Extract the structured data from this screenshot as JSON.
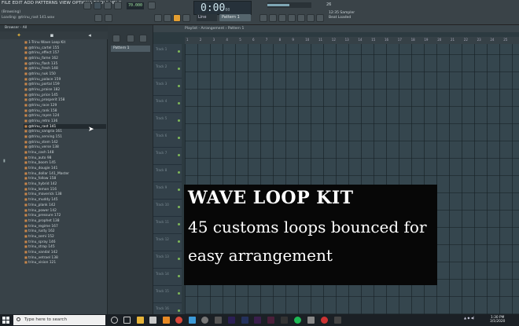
{
  "menubar": "FILE EDIT ADD PATTERNS VIEW OPTIONS TOOLS HELP",
  "hints": [
    "(Browsing)",
    "Loading: @trinu_rast 141.wav"
  ],
  "transport": {
    "tempo": "70.000",
    "time_main": "0:00",
    "time_small": "00",
    "mode": "Line",
    "pattern": "Pattern 1",
    "percent": "26"
  },
  "info": {
    "line1": "12:35 Sampler",
    "line2": "Beat Loaded",
    "line3": "Master"
  },
  "browser": {
    "header": "Browser - All"
  },
  "files": [
    "1-Trinu Wave Loop Kit",
    "@trinu_cartel 155",
    "@trinu_effect 157",
    "@trinu_fame 162",
    "@trinu_flash 135",
    "@trinu_fresh 148",
    "@trinu_nuk 150",
    "@trinu_palace 159",
    "@trinu_portal 159",
    "@trinu_praise 182",
    "@trinu_price 145",
    "@trinu_prosperit 158",
    "@trinu_race 129",
    "@trinu_rank 158",
    "@trinu_rayen 124",
    "@trinu_retro 136",
    "@trinu_rast 141",
    "@trinu_sangria 161",
    "@trinu_serving 151",
    "@trinu_stem 142",
    "@trinu_verse 138",
    "trinu_cash 148",
    "trinu_auto 98",
    "trinu_boom 145",
    "trinu_dougie 141",
    "trinu_dollar 141_Master",
    "trinu_follow 158",
    "trinu_hybrid 142",
    "trinu_lemon 116",
    "trinu_maverick 138",
    "trinu_muddy 145",
    "trinu_plank 142",
    "trinu_power 142",
    "trinu_pressure 172",
    "trinu_prophet 138",
    "trinu_regime 167",
    "trinu_rusty 162",
    "trinu_semi 152",
    "trinu_spray 146",
    "trinu_strap 145",
    "trinu_vandal 142",
    "trinu_vetrael 138",
    "trinu_vision 121"
  ],
  "selected_file_index": 16,
  "mid": {
    "pattern_label": "Pattern 1"
  },
  "playlist": {
    "title": "Playlist - Arrangement › Pattern 1"
  },
  "ruler": [
    "1",
    "2",
    "3",
    "4",
    "5",
    "6",
    "7",
    "8",
    "9",
    "10",
    "11",
    "12",
    "13",
    "14",
    "15",
    "16",
    "17",
    "18",
    "19",
    "20",
    "21",
    "22",
    "23",
    "24",
    "25"
  ],
  "tracks": [
    "Track 1",
    "Track 2",
    "Track 3",
    "Track 4",
    "Track 5",
    "Track 6",
    "Track 7",
    "Track 8",
    "Track 9",
    "Track 10",
    "Track 11",
    "Track 12",
    "Track 13",
    "Track 14",
    "Track 15",
    "Track 16"
  ],
  "overlay": {
    "title": "WAVE LOOP KIT",
    "line1": "45 customs loops bounced for",
    "line2": "easy arrangement"
  },
  "taskbar": {
    "search_placeholder": "Type here to search",
    "time": "1:30 PM",
    "date": "3/1/2020"
  },
  "colors": {
    "accent": "#e39e31",
    "overlay_bg": "#070707",
    "grid": "#35464e"
  }
}
